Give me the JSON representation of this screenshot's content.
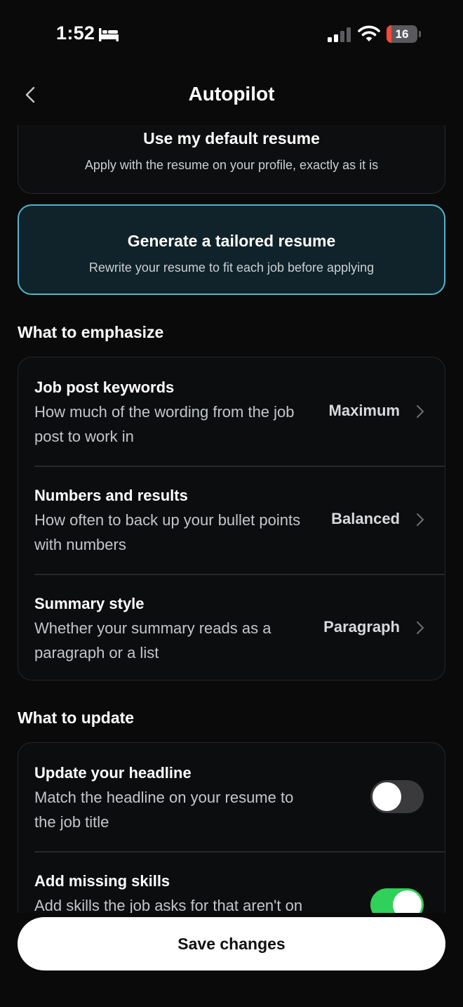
{
  "status_bar": {
    "time": "1:52",
    "battery_level": "16",
    "battery_fraction": 0.16,
    "signal_bars_active": 2,
    "signal_bars_total": 4,
    "icons": [
      "bed-icon",
      "signal-icon",
      "wifi-icon",
      "battery-icon"
    ]
  },
  "nav": {
    "title": "Autopilot",
    "back_icon": "chevron-left-icon"
  },
  "resume_options": [
    {
      "title": "Use my default resume",
      "description": "Apply with the resume on your profile, exactly as it is",
      "selected": false
    },
    {
      "title": "Generate a tailored resume",
      "description": "Rewrite your resume to fit each job before applying",
      "selected": true
    }
  ],
  "emphasize": {
    "title": "What to emphasize",
    "rows": [
      {
        "title": "Job post keywords",
        "description": "How much of the wording from the job post to work in",
        "value": "Maximum"
      },
      {
        "title": "Numbers and results",
        "description": "How often to back up your bullet points with numbers",
        "value": "Balanced"
      },
      {
        "title": "Summary style",
        "description": "Whether your summary reads as a paragraph or a list",
        "value": "Paragraph"
      }
    ]
  },
  "update": {
    "title": "What to update",
    "rows": [
      {
        "title": "Update your headline",
        "description": "Match the headline on your resume to the job title",
        "enabled": false
      },
      {
        "title": "Add missing skills",
        "description": "Add skills the job asks for that aren't on",
        "enabled": true
      }
    ]
  },
  "colors": {
    "background": "#0a0a0b",
    "selected_border": "#4fb6cc",
    "toggle_on": "#30d158",
    "battery_low": "#ff453a"
  },
  "save_label": "Save changes"
}
